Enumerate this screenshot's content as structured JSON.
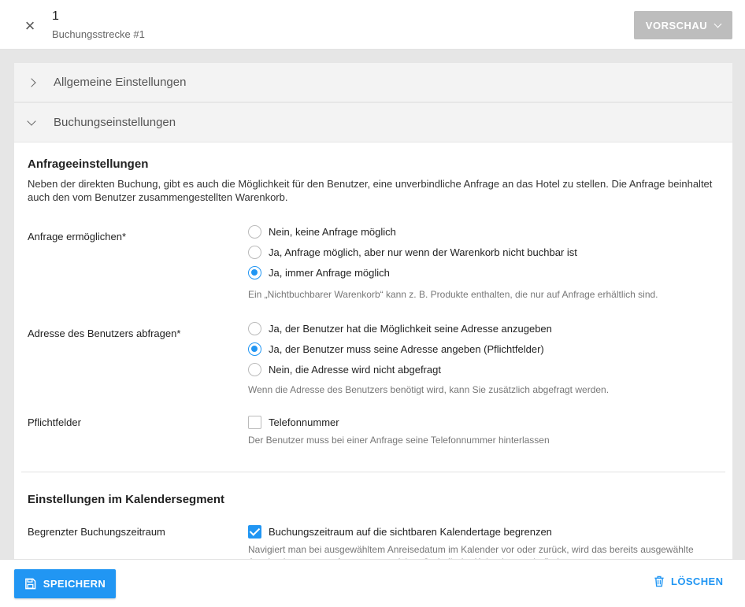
{
  "header": {
    "title": "1",
    "subtitle": "Buchungsstrecke #1",
    "close_icon": "close-icon",
    "preview_label": "VORSCHAU"
  },
  "accordion": {
    "general_label": "Allgemeine Einstellungen",
    "booking_label": "Buchungseinstellungen"
  },
  "inquiry": {
    "title": "Anfrageeinstellungen",
    "description": "Neben der direkten Buchung, gibt es auch die Möglichkeit für den Benutzer, eine unverbindliche Anfrage an das Hotel zu stellen. Die Anfrage beinhaltet auch den vom Benutzer zusammengestellten Warenkorb.",
    "enable_label": "Anfrage ermöglichen*",
    "enable_options": [
      "Nein, keine Anfrage möglich",
      "Ja, Anfrage möglich, aber nur wenn der Warenkorb nicht buchbar ist",
      "Ja, immer Anfrage möglich"
    ],
    "enable_selected": 2,
    "enable_hint": "Ein „Nichtbuchbarer Warenkorb“ kann z. B. Produkte enthalten, die nur auf Anfrage erhältlich sind.",
    "address_label": "Adresse des Benutzers abfragen*",
    "address_options": [
      "Ja, der Benutzer hat die Möglichkeit seine Adresse anzugeben",
      "Ja, der Benutzer muss seine Adresse angeben (Pflichtfelder)",
      "Nein, die Adresse wird nicht abgefragt"
    ],
    "address_selected": 1,
    "address_hint": "Wenn die Adresse des Benutzers benötigt wird, kann Sie zusätzlich abgefragt werden.",
    "required_label": "Pflichtfelder",
    "phone_label": "Telefonnummer",
    "phone_checked": false,
    "phone_hint": "Der Benutzer muss bei einer Anfrage seine Telefonnummer hinterlassen"
  },
  "calendar": {
    "title": "Einstellungen im Kalendersegment",
    "limit_label": "Begrenzter Buchungszeitraum",
    "limit_option": "Buchungszeitraum auf die sichtbaren Kalendertage begrenzen",
    "limit_checked": true,
    "limit_hint": "Navigiert man bei ausgewähltem Anreisedatum im Kalender vor oder zurück, wird das bereits ausgewählte Anreisedatum verworfen, wenn es sich außerhalb der Kalendertage befindet."
  },
  "footer": {
    "save_label": "SPEICHERN",
    "delete_label": "LÖSCHEN"
  },
  "colors": {
    "accent": "#2196f3",
    "preview_bg": "#bdbdbd",
    "page_bg": "#e6e6e6"
  }
}
